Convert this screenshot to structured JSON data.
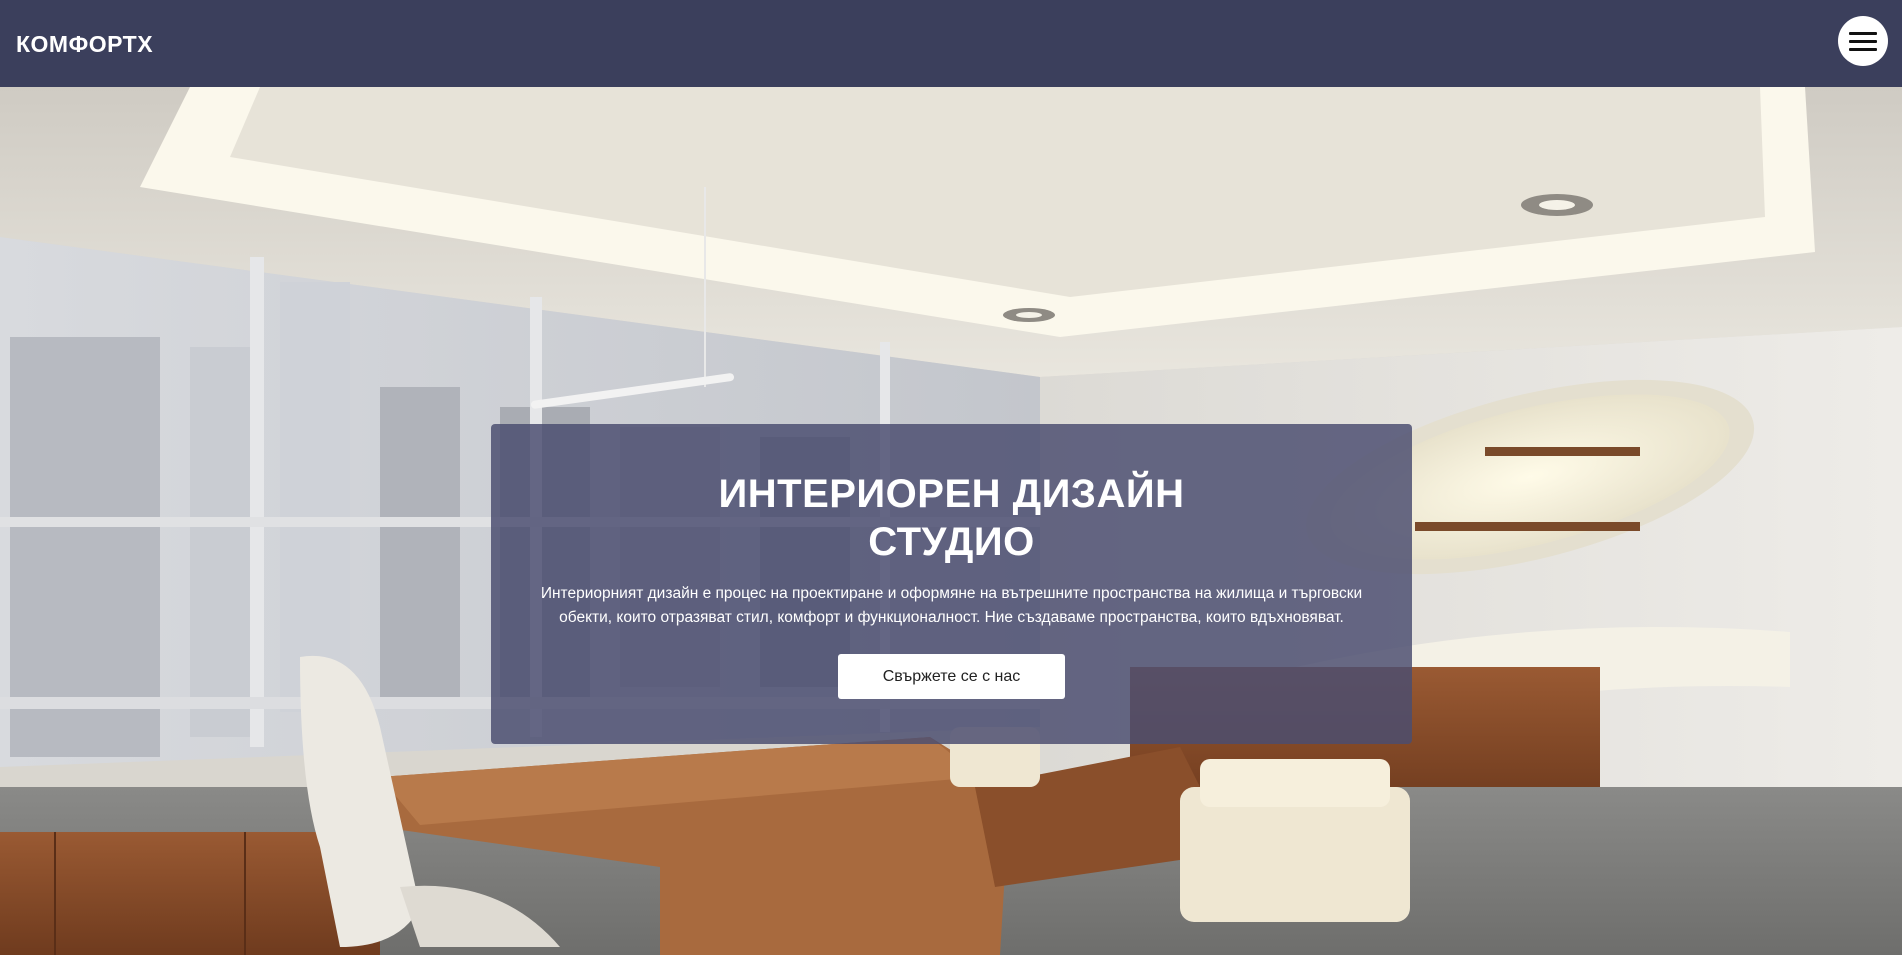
{
  "header": {
    "brand": "КОМФОРТХ",
    "menu_icon": "hamburger-menu-icon"
  },
  "hero": {
    "background": "office-interior-photo",
    "title_line1": "ИНТЕРИОРЕН ДИЗАЙН",
    "title_line2": "СТУДИО",
    "text_line1": "Интериорният дизайн е процес на проектиране и оформяне на вътрешните пространства на жилища и търговски",
    "text_line2": "обекти, които отразяват стил, комфорт и функционалност. Ние създаваме пространства, които вдъхновяват.",
    "cta_label": "Свържете се с нас"
  },
  "colors": {
    "header_bg": "#3b3f5c",
    "card_bg": "#4b4e70",
    "text": "#ffffff",
    "button_bg": "#ffffff"
  }
}
